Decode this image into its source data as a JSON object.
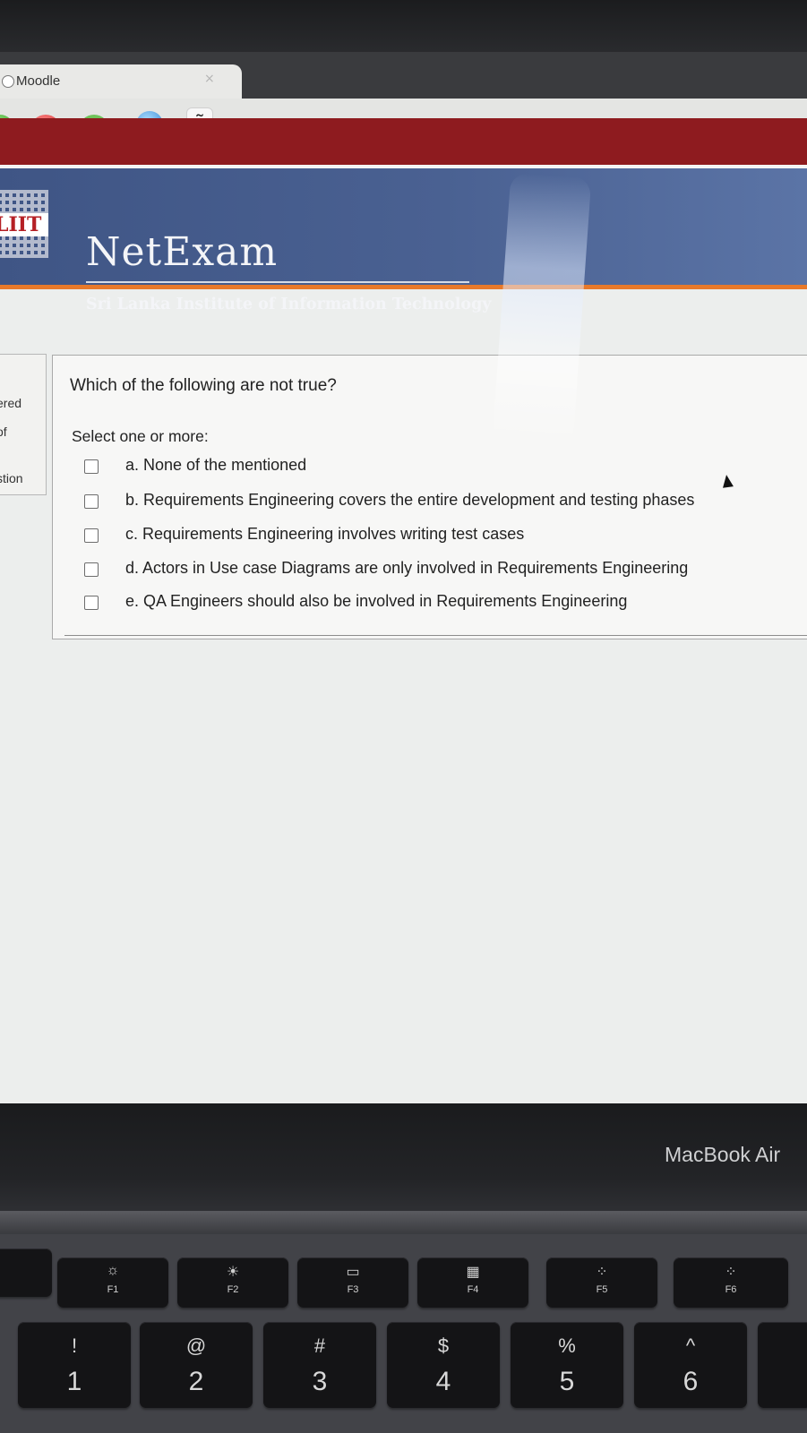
{
  "browser": {
    "tab_title": "Moodle",
    "tab_close": "×",
    "font_button": "Ã"
  },
  "header": {
    "logo_text": "LIIT",
    "title": "NetExam",
    "subtitle": "Sri Lanka Institute of Information Technology",
    "accent_color": "#e8792a",
    "band_color": "#8e1b1f"
  },
  "info_block": {
    "lines": [
      "ered",
      "of",
      "stion"
    ]
  },
  "question": {
    "text": "Which of the following are not true?",
    "instruction": "Select one or more:",
    "options": [
      {
        "label": "a. None of the mentioned",
        "checked": false
      },
      {
        "label": "b. Requirements Engineering covers the entire development and testing phases",
        "checked": false
      },
      {
        "label": "c. Requirements Engineering involves writing test cases",
        "checked": false
      },
      {
        "label": "d. Actors in Use case Diagrams are only involved in Requirements Engineering",
        "checked": false
      },
      {
        "label": "e. QA Engineers should also be involved in Requirements Engineering",
        "checked": false
      }
    ]
  },
  "device": {
    "label": "MacBook Air"
  },
  "keyboard": {
    "function_keys": [
      {
        "label": "F1",
        "icon": "☼"
      },
      {
        "label": "F2",
        "icon": "☀"
      },
      {
        "label": "F3",
        "icon": "▭"
      },
      {
        "label": "F4",
        "icon": "▦"
      },
      {
        "label": "F5",
        "icon": "⁘"
      },
      {
        "label": "F6",
        "icon": "⁘"
      }
    ],
    "number_keys": [
      {
        "symbol": "!",
        "number": "1"
      },
      {
        "symbol": "@",
        "number": "2"
      },
      {
        "symbol": "#",
        "number": "3"
      },
      {
        "symbol": "$",
        "number": "4"
      },
      {
        "symbol": "%",
        "number": "5"
      },
      {
        "symbol": "^",
        "number": "6"
      }
    ]
  }
}
